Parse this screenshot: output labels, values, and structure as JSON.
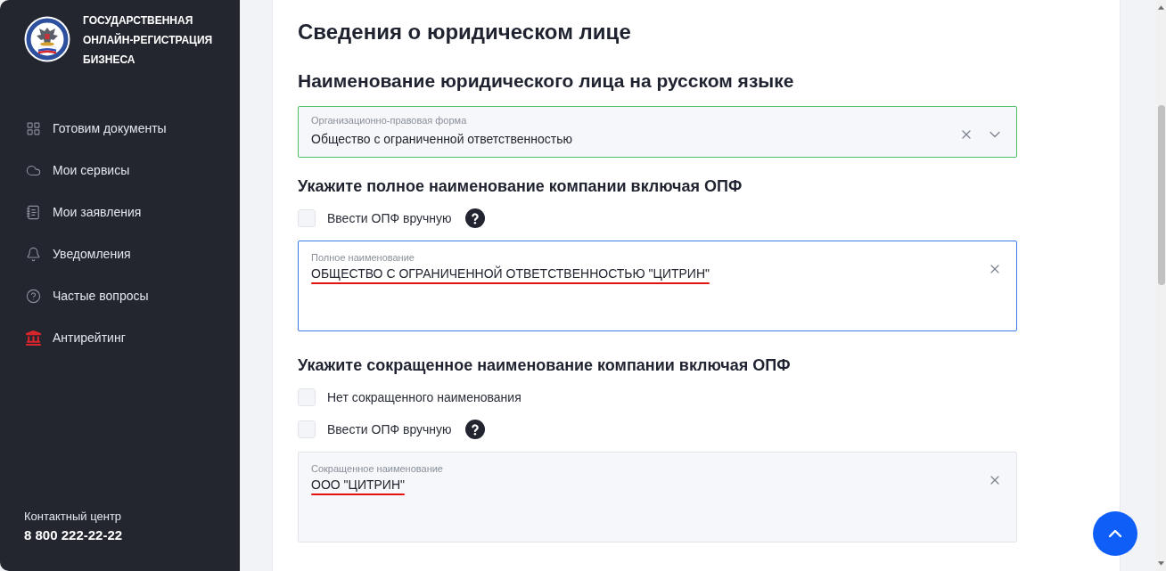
{
  "sidebar": {
    "brand_lines": [
      "ГОСУДАРСТВЕННАЯ",
      "ОНЛАЙН-РЕГИСТРАЦИЯ",
      "БИЗНЕСА"
    ],
    "items": [
      {
        "label": "Готовим документы",
        "selected": false
      },
      {
        "label": "Мои сервисы",
        "selected": false
      },
      {
        "label": "Мои заявления",
        "selected": false
      },
      {
        "label": "Уведомления",
        "selected": false
      },
      {
        "label": "Частые вопросы",
        "selected": false
      },
      {
        "label": "Антирейтинг",
        "selected": false
      }
    ],
    "contact": {
      "label": "Контактный центр",
      "phone": "8 800 222-22-22"
    }
  },
  "form": {
    "title": "Сведения о юридическом лице",
    "subtitle": "Наименование юридического лица на русском языке",
    "legal_form": {
      "label": "Организационно-правовая форма",
      "value": "Общество с ограниченной ответственностью",
      "valid": true
    },
    "sections": [
      {
        "heading": "Укажите полное наименование компании включая ОПФ",
        "options": [
          {
            "label": "Ввести ОПФ вручную",
            "checked": false,
            "help": true
          }
        ],
        "field": {
          "label": "Полное наименование",
          "value": "ОБЩЕСТВО С ОГРАНИЧЕННОЙ ОТВЕТСТВЕННОСТЬЮ \"ЦИТРИН\"",
          "focused": true,
          "annotated": true
        }
      },
      {
        "heading": "Укажите сокращенное наименование компании включая ОПФ",
        "options": [
          {
            "label": "Нет сокращенного наименования",
            "checked": false,
            "help": false
          },
          {
            "label": "Ввести ОПФ вручную",
            "checked": false,
            "help": true
          }
        ],
        "field": {
          "label": "Сокращенное наименование",
          "value": "ООО \"ЦИТРИН\"",
          "focused": false,
          "annotated": true
        }
      }
    ]
  }
}
